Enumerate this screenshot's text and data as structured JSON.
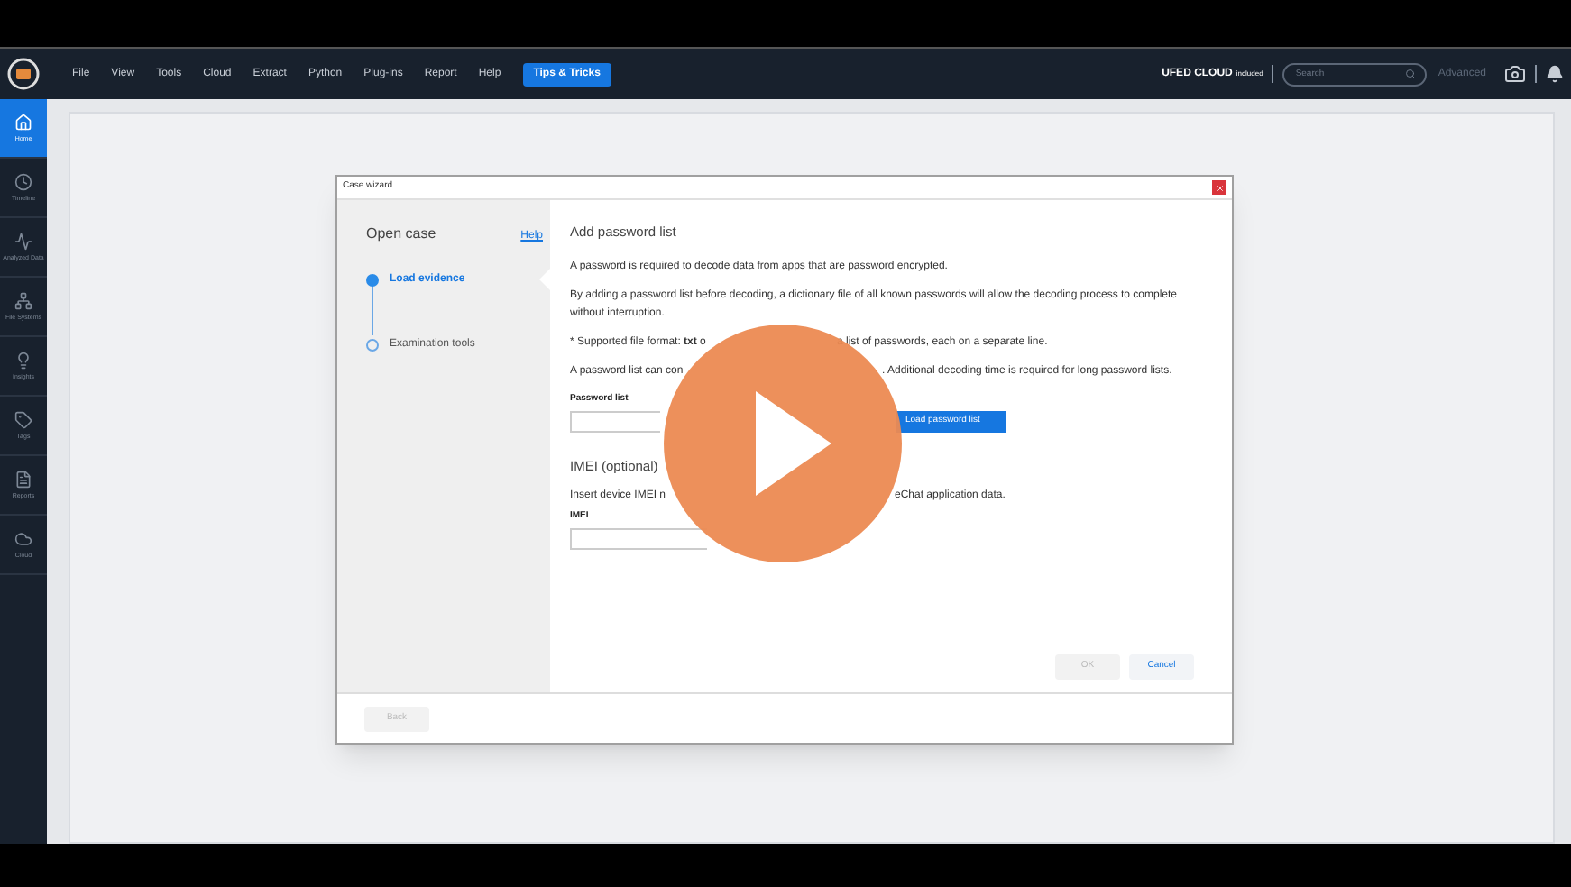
{
  "menu": [
    "File",
    "View",
    "Tools",
    "Cloud",
    "Extract",
    "Python",
    "Plug-ins",
    "Report",
    "Help"
  ],
  "tips_button": "Tips & Tricks",
  "cloud_badge": {
    "name": "UFED CLOUD",
    "note": "included"
  },
  "search": {
    "placeholder": "Search"
  },
  "advanced_link": "Advanced",
  "sidebar": [
    {
      "label": "Home",
      "kind": "home",
      "selected": true
    },
    {
      "label": "Timeline",
      "kind": "clock",
      "selected": false
    },
    {
      "label": "Analyzed Data",
      "kind": "pulse",
      "selected": false
    },
    {
      "label": "File Systems",
      "kind": "tree",
      "selected": false
    },
    {
      "label": "Insights",
      "kind": "bulb",
      "selected": false
    },
    {
      "label": "Tags",
      "kind": "tag",
      "selected": false
    },
    {
      "label": "Reports",
      "kind": "report",
      "selected": false
    },
    {
      "label": "Cloud",
      "kind": "cloud",
      "selected": false
    }
  ],
  "dialog": {
    "title": "Case wizard",
    "heading": "Open case",
    "help": "Help",
    "steps": [
      {
        "label": "Load evidence",
        "selected": true
      },
      {
        "label": "Examination tools",
        "selected": false
      }
    ],
    "section_title": "Add password list",
    "paragraphs": [
      {
        "parts": [
          "A password is required to decode data from apps that are password encrypted."
        ]
      },
      {
        "parts": [
          "By adding a password list before decoding, a dictionary file of all known passwords will allow the decoding process to complete without interruption."
        ]
      },
      {
        "parts": [
          "* Supported file format: **txt** o",
          "a list of passwords, each on a separate line."
        ]
      },
      {
        "parts": [
          "A password list can con",
          ". Additional decoding time is required for long password lists."
        ]
      }
    ],
    "password_field": {
      "label": "Password list"
    },
    "load_button": "Load password list",
    "imei_title": "IMEI (optional)",
    "imei_text": {
      "parts": [
        "Insert device IMEI n",
        "eChat application data."
      ]
    },
    "imei_field": {
      "label": "IMEI"
    },
    "buttons": [
      {
        "label": "OK",
        "disabled": true
      },
      {
        "label": "Cancel",
        "disabled": false
      }
    ],
    "back": {
      "label": "Back",
      "disabled": true
    }
  }
}
